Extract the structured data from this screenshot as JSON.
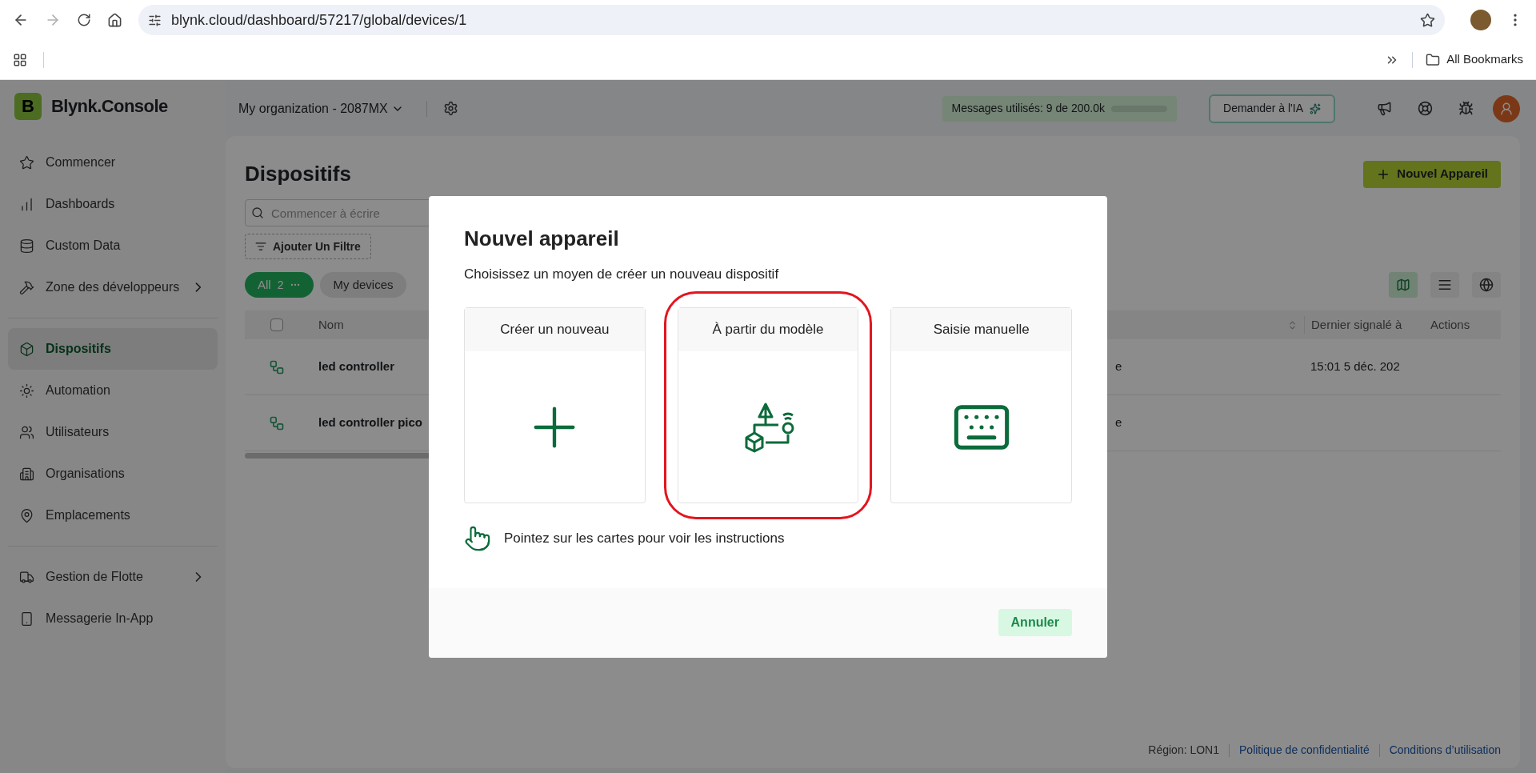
{
  "browser": {
    "url": "blynk.cloud/dashboard/57217/global/devices/1",
    "bookmark_folder": "All Bookmarks"
  },
  "app": {
    "logo_letter": "B",
    "brand": "Blynk.Console"
  },
  "header": {
    "organization": "My organization - 2087MX",
    "usage": {
      "label": "Messages utilisés: 9 de 200.0k",
      "level": 0
    },
    "ai_button": "Demander à l'IA"
  },
  "sidebar": {
    "sections": [
      [
        {
          "label": "Commencer",
          "selected": false,
          "has_submenu": false
        },
        {
          "label": "Dashboards",
          "selected": false,
          "has_submenu": false
        },
        {
          "label": "Custom Data",
          "selected": false,
          "has_submenu": false
        },
        {
          "label": "Zone des développeurs",
          "selected": false,
          "has_submenu": true
        }
      ],
      [
        {
          "label": "Dispositifs",
          "selected": true,
          "has_submenu": false
        },
        {
          "label": "Automation",
          "selected": false,
          "has_submenu": false
        },
        {
          "label": "Utilisateurs",
          "selected": false,
          "has_submenu": false
        },
        {
          "label": "Organisations",
          "selected": false,
          "has_submenu": false
        },
        {
          "label": "Emplacements",
          "selected": false,
          "has_submenu": false
        }
      ],
      [
        {
          "label": "Gestion de Flotte",
          "selected": false,
          "has_submenu": true
        },
        {
          "label": "Messagerie In-App",
          "selected": false,
          "has_submenu": false
        }
      ]
    ]
  },
  "page": {
    "title": "Dispositifs",
    "new_button": "Nouvel Appareil",
    "search": {
      "placeholder": "Commencer à écrire"
    },
    "filter_button": "Ajouter Un Filtre",
    "chips": [
      {
        "label": "All",
        "count": "2",
        "selected": true
      },
      {
        "label": "My devices",
        "selected": false
      }
    ],
    "views": [
      {
        "kind": "map",
        "selected": true
      },
      {
        "kind": "list",
        "selected": false
      },
      {
        "kind": "globe",
        "selected": false
      }
    ],
    "table": {
      "select_all_checked": false,
      "columns": [
        "Nom",
        "Dernier signalé à",
        "Actions"
      ],
      "rows": [
        {
          "name": "led controller",
          "column_3": "e",
          "last_reported": "15:01 5 déc. 202"
        },
        {
          "name": "led controller pico",
          "column_3": "e"
        }
      ]
    }
  },
  "modal": {
    "title": "Nouvel appareil",
    "subtitle": "Choisissez un moyen de créer un nouveau dispositif",
    "options": [
      {
        "label": "Créer un nouveau",
        "kind": "create",
        "highlighted": false
      },
      {
        "label": "À partir du modèle",
        "kind": "template",
        "highlighted": true
      },
      {
        "label": "Saisie manuelle",
        "kind": "manual",
        "highlighted": false
      }
    ],
    "hint": "Pointez sur les cartes pour voir les instructions",
    "cancel": "Annuler"
  },
  "footer": {
    "region": "Région: LON1",
    "links": [
      "Politique de confidentialité",
      "Conditions d’utilisation"
    ]
  }
}
